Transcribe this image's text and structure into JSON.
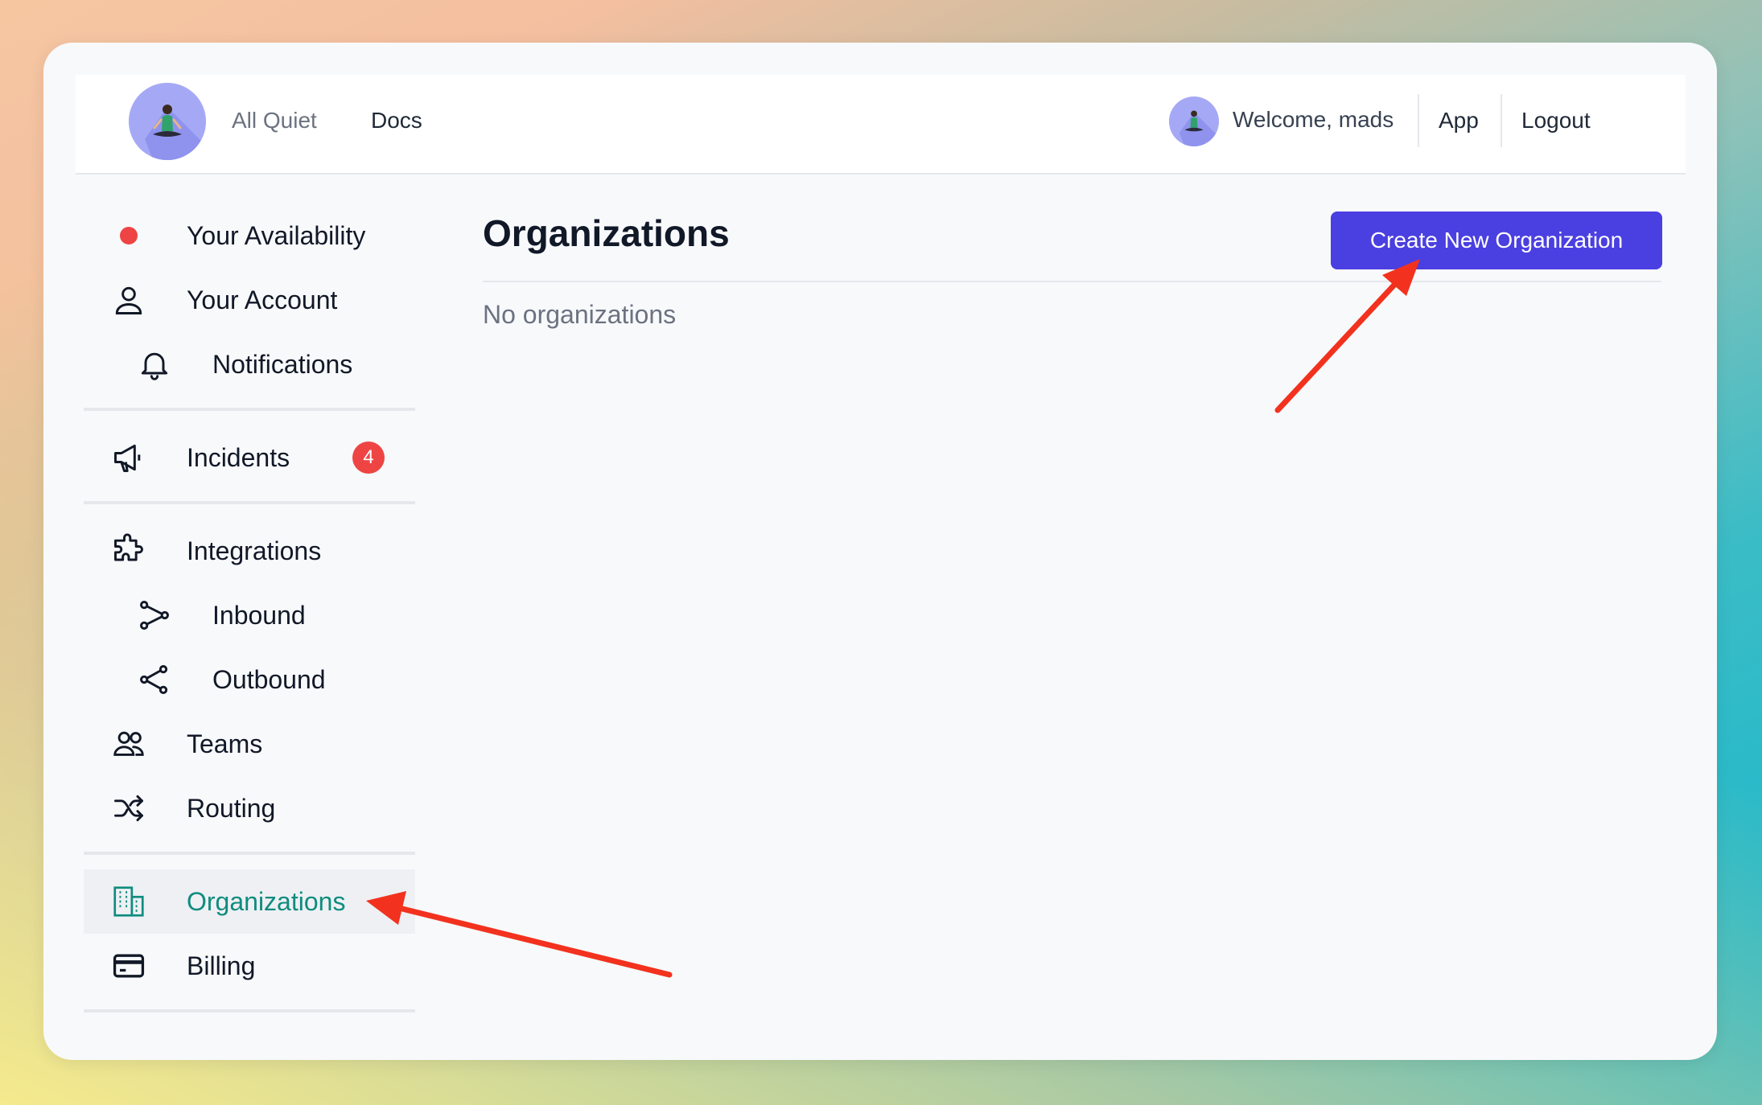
{
  "topbar": {
    "brand_label": "All Quiet",
    "docs_label": "Docs",
    "welcome_text": "Welcome, mads",
    "app_label": "App",
    "logout_label": "Logout"
  },
  "sidebar": {
    "items": [
      {
        "label": "Your Availability",
        "icon": "status-dot-icon"
      },
      {
        "label": "Your Account",
        "icon": "user-icon"
      },
      {
        "label": "Notifications",
        "icon": "bell-icon"
      },
      {
        "label": "Incidents",
        "icon": "megaphone-icon",
        "badge": "4"
      },
      {
        "label": "Integrations",
        "icon": "puzzle-icon"
      },
      {
        "label": "Inbound",
        "icon": "merge-icon"
      },
      {
        "label": "Outbound",
        "icon": "share-icon"
      },
      {
        "label": "Teams",
        "icon": "users-icon"
      },
      {
        "label": "Routing",
        "icon": "shuffle-icon"
      },
      {
        "label": "Organizations",
        "icon": "building-icon",
        "active": true
      },
      {
        "label": "Billing",
        "icon": "credit-card-icon"
      }
    ]
  },
  "main": {
    "title": "Organizations",
    "empty_text": "No organizations",
    "create_button_label": "Create New Organization"
  },
  "colors": {
    "accent": "#4a3fe0",
    "active": "#0f8c7e",
    "alert": "#ef4444",
    "annotation_arrow": "#f2321e"
  }
}
